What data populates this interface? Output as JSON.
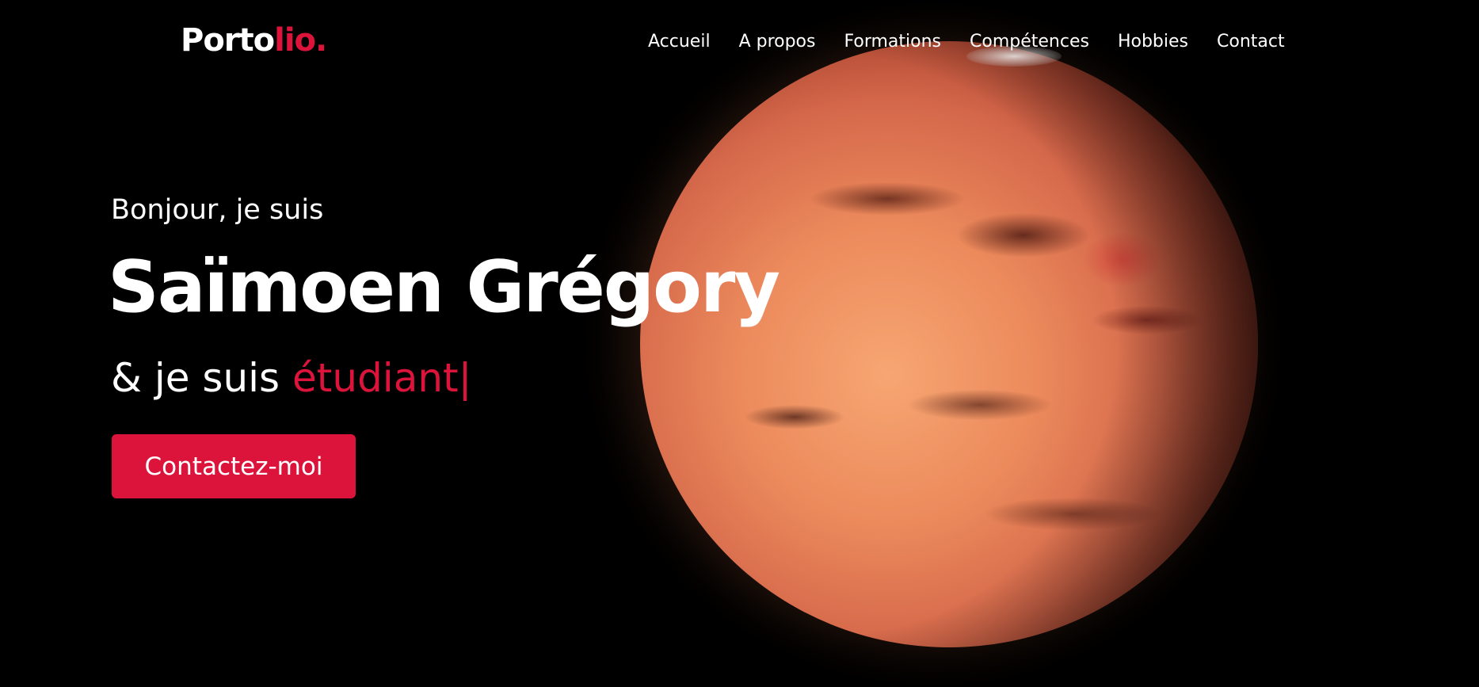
{
  "logo": {
    "part1": "Porto",
    "part2": "lio",
    "dot": "."
  },
  "nav": {
    "items": [
      "Accueil",
      "A propos",
      "Formations",
      "Compétences",
      "Hobbies",
      "Contact"
    ]
  },
  "hero": {
    "greeting": "Bonjour, je suis",
    "name": "Saïmoen Grégory",
    "role_prefix": "& je suis ",
    "role_typed": "étudiant",
    "cursor": "|",
    "cta_label": "Contactez-moi"
  },
  "colors": {
    "background": "#000000",
    "accent": "#dc143c",
    "text": "#ffffff"
  },
  "images": {
    "hero_background": "planet-illustration"
  }
}
